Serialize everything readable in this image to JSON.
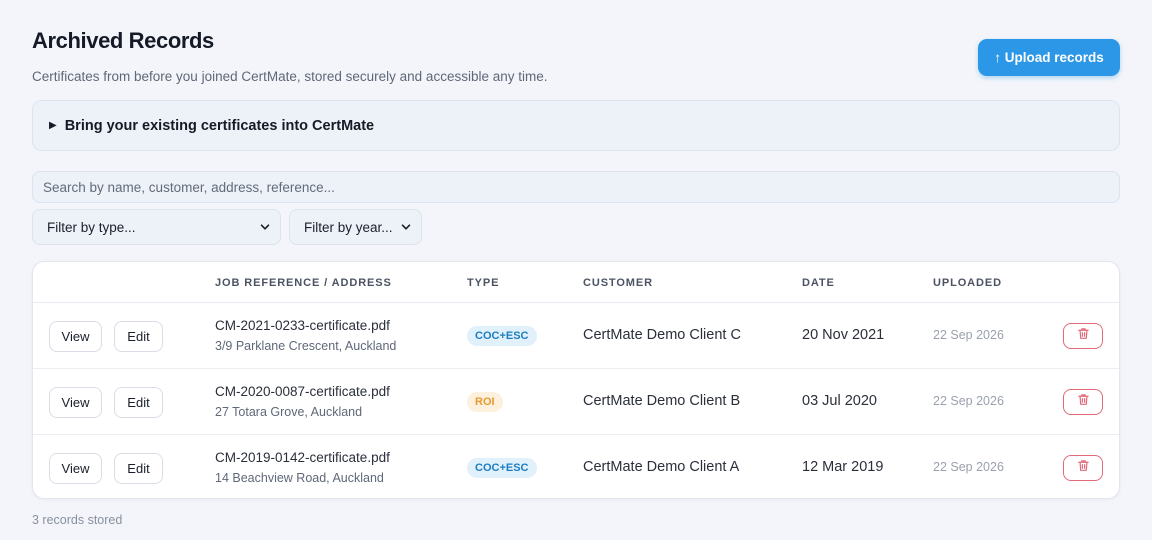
{
  "page": {
    "title": "Archived Records",
    "subtitle": "Certificates from before you joined CertMate, stored securely and accessible any time.",
    "upload_label": "↑ Upload records"
  },
  "import_panel": {
    "arrow": "▶",
    "label": "Bring your existing certificates into CertMate"
  },
  "search": {
    "placeholder": "Search by name, customer, address, reference..."
  },
  "filters": {
    "type_label": "Filter by type...",
    "year_label": "Filter by year..."
  },
  "table": {
    "headers": {
      "job": "JOB REFERENCE / ADDRESS",
      "type": "TYPE",
      "customer": "CUSTOMER",
      "date": "DATE",
      "uploaded": "UPLOADED"
    },
    "view_label": "View",
    "edit_label": "Edit",
    "rows": [
      {
        "file": "CM-2021-0233-certificate.pdf",
        "address": "3/9 Parklane Crescent, Auckland",
        "type": "COC+ESC",
        "type_color": "blue",
        "customer": "CertMate Demo Client C",
        "date": "20 Nov 2021",
        "uploaded": "22 Sep 2026"
      },
      {
        "file": "CM-2020-0087-certificate.pdf",
        "address": "27 Totara Grove, Auckland",
        "type": "ROI",
        "type_color": "orange",
        "customer": "CertMate Demo Client B",
        "date": "03 Jul 2020",
        "uploaded": "22 Sep 2026"
      },
      {
        "file": "CM-2019-0142-certificate.pdf",
        "address": "14 Beachview Road, Auckland",
        "type": "COC+ESC",
        "type_color": "blue",
        "customer": "CertMate Demo Client A",
        "date": "12 Mar 2019",
        "uploaded": "22 Sep 2026"
      }
    ]
  },
  "footer": {
    "count_text": "3 records stored"
  },
  "colors": {
    "accent": "#2b97e6",
    "danger": "#e06a78",
    "badge_blue": "#1e7dc0",
    "badge_orange": "#e49a35"
  },
  "icons": {
    "delete": "trash-icon",
    "select": "chevron-down-icon",
    "disclosure": "triangle-right-icon"
  }
}
